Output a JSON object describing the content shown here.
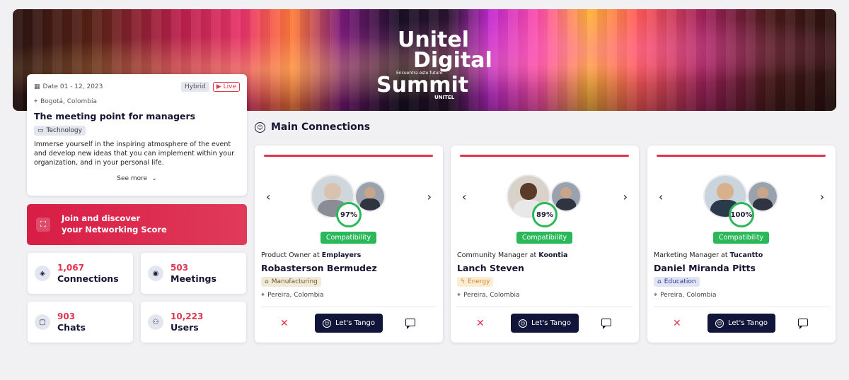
{
  "banner": {
    "logo_line1": "Unitel",
    "logo_line2": "Digital",
    "logo_tagline": "Encuentra este futuro",
    "logo_line3": "Summit",
    "logo_brand": "UNITEL"
  },
  "event": {
    "date": "Date 01 - 12, 2023",
    "hybrid_badge": "Hybrid",
    "live_badge": "Live",
    "location": "Bogotá, Colombia",
    "title": "The meeting point for managers",
    "category": "Technology",
    "description": "Immerse yourself in the inspiring atmosphere of the event and develop new ideas that you can implement within your organization, and in your personal life.",
    "see_more": "See more"
  },
  "networking": {
    "line1": "Join and discover",
    "line2": "your Networking Score"
  },
  "stats": {
    "connections": {
      "value": "1,067",
      "label": "Connections"
    },
    "meetings": {
      "value": "503",
      "label": "Meetings"
    },
    "chats": {
      "value": "903",
      "label": "Chats"
    },
    "users": {
      "value": "10,223",
      "label": "Users"
    }
  },
  "section_title": "Main Connections",
  "connections": [
    {
      "score": "97%",
      "compat_label": "Compatibility",
      "role": "Product Owner at",
      "company": "Emplayers",
      "name": "Robasterson Bermudez",
      "industry": "Manufacturing",
      "location": "Pereira, Colombia",
      "tango_label": "Let's Tango"
    },
    {
      "score": "89%",
      "compat_label": "Compatibility",
      "role": "Community Manager at",
      "company": "Koontia",
      "name": "Lanch Steven",
      "industry": "Energy",
      "location": "Pereira, Colombia",
      "tango_label": "Let's Tango"
    },
    {
      "score": "100%",
      "compat_label": "Compatibility",
      "role": "Marketing Manager at",
      "company": "Tucantto",
      "name": "Daniel Miranda Pitts",
      "industry": "Education",
      "location": "Pereira, Colombia",
      "tango_label": "Let's Tango"
    }
  ],
  "colors": {
    "accent": "#e0344f",
    "dark": "#12153a",
    "success": "#2ab85a"
  }
}
